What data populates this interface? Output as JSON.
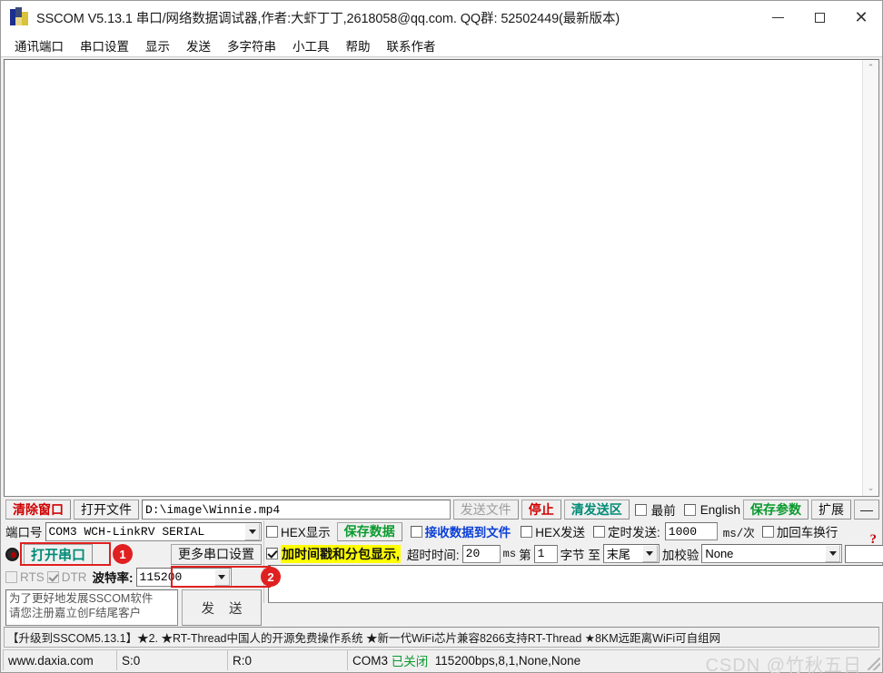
{
  "window": {
    "title": "SSCOM V5.13.1 串口/网络数据调试器,作者:大虾丁丁,2618058@qq.com. QQ群: 52502449(最新版本)",
    "icon": "sscom-app-icon",
    "minimize": "–",
    "maximize": "□",
    "close": "✕"
  },
  "menu": {
    "items": [
      {
        "label": "通讯端口"
      },
      {
        "label": "串口设置"
      },
      {
        "label": "显示"
      },
      {
        "label": "发送"
      },
      {
        "label": "多字符串"
      },
      {
        "label": "小工具"
      },
      {
        "label": "帮助"
      },
      {
        "label": "联系作者"
      }
    ]
  },
  "receive": {
    "text": "",
    "scroll_up": "⌃",
    "scroll_down": "⌄"
  },
  "file_row": {
    "clear_window": "清除窗口",
    "open_file": "打开文件",
    "file_path": "D:\\image\\Winnie.mp4",
    "send_file": "发送文件",
    "stop": "停止",
    "clear_send": "清发送区",
    "topmost_label": "最前",
    "topmost_checked": false,
    "english_label": "English",
    "english_checked": false,
    "save_params": "保存参数",
    "extend": "扩展",
    "collapse": "—"
  },
  "serial": {
    "port_label": "端口号",
    "port_value": "COM3 WCH-LinkRV SERIAL",
    "open_port_button": "打开串口",
    "more_settings_button": "更多串口设置",
    "rts_label": "RTS",
    "rts_checked": false,
    "dtr_label": "DTR",
    "dtr_checked": true,
    "baud_label": "波特率:",
    "baud_value": "115200",
    "send_note": "为了更好地发展SSCOM软件\n请您注册嘉立创F结尾客户",
    "send_button": "发 送"
  },
  "options": {
    "hex_display_label": "HEX显示",
    "hex_display_checked": false,
    "save_data_button": "保存数据",
    "recv_to_file_label": "接收数据到文件",
    "recv_to_file_checked": false,
    "hex_send_label": "HEX发送",
    "hex_send_checked": false,
    "timed_send_label": "定时发送:",
    "timed_send_checked": false,
    "timed_send_value": "1000",
    "timed_send_unit": "ms/次",
    "crlf_label": "加回车换行",
    "crlf_checked": false,
    "timestamp_label": "加时间戳和分包显示,",
    "timestamp_checked": true,
    "timeout_label": "超时时间:",
    "timeout_value": "20",
    "timeout_unit": "ms",
    "byte_prefix": "第",
    "byte_index": "1",
    "byte_label": "字节 至",
    "byte_end": "末尾",
    "checksum_label": "加校验",
    "checksum_value": "None",
    "extra_value": "",
    "help_mark": "?"
  },
  "annotations": {
    "badge1": "1",
    "badge2": "2"
  },
  "ad_banner": {
    "text": "【升级到SSCOM5.13.1】★2.  ★RT-Thread中国人的开源免费操作系统 ★新一代WiFi芯片兼容8266支持RT-Thread ★8KM远距离WiFi可自组网"
  },
  "status": {
    "url": "www.daxia.com",
    "sent": "S:0",
    "received": "R:0",
    "port": "COM3",
    "state": "已关闭",
    "params": "115200bps,8,1,None,None",
    "watermark": "CSDN @竹秋五日"
  },
  "colors": {
    "accent_red": "#e02020",
    "teal": "#008b76",
    "green": "#0a9a2e",
    "blue": "#0b3fd6",
    "highlight": "#ffff00"
  }
}
